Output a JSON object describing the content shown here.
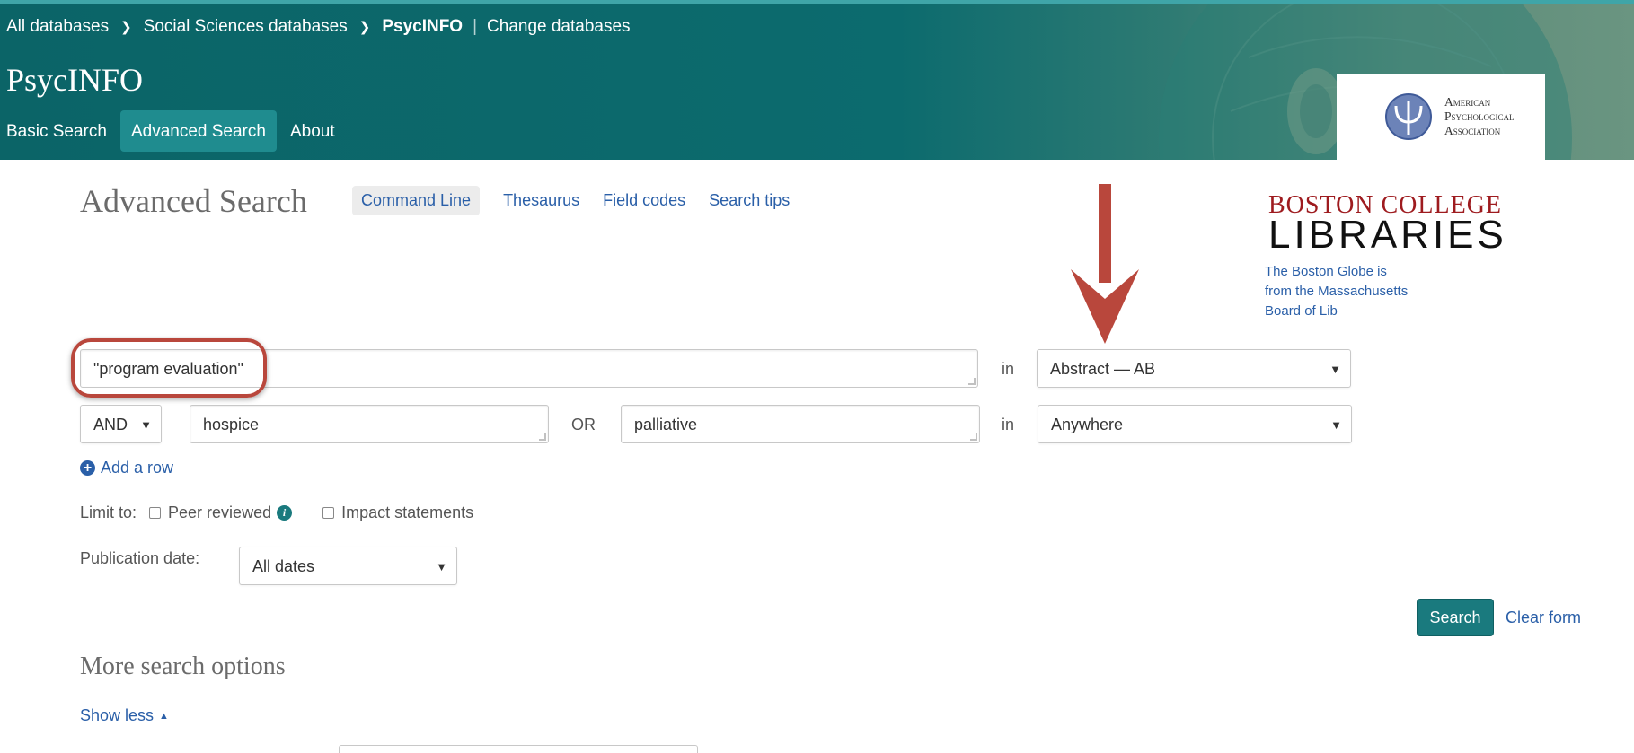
{
  "breadcrumb": {
    "items": [
      "All databases",
      "Social Sciences databases",
      "PsycINFO"
    ],
    "change_link": "Change databases"
  },
  "database_title": "PsycINFO",
  "nav": {
    "basic": "Basic Search",
    "advanced": "Advanced Search",
    "about": "About"
  },
  "apa_logo": {
    "line1": "American",
    "line2": "Psychological",
    "line3": "Association"
  },
  "page": {
    "title": "Advanced Search",
    "links": {
      "command_line": "Command Line",
      "thesaurus": "Thesaurus",
      "field_codes": "Field codes",
      "search_tips": "Search tips"
    }
  },
  "library": {
    "line1": "BOSTON COLLEGE",
    "line2": "LIBRARIES",
    "note": "The Boston Globe is from the Massachusetts Board of Lib"
  },
  "search_rows": {
    "row1": {
      "value": "\"program evaluation\"",
      "in_label": "in",
      "field": "Abstract — AB"
    },
    "row2": {
      "operator": "AND",
      "value1": "hospice",
      "or_label": "OR",
      "value2": "palliative",
      "in_label": "in",
      "field": "Anywhere"
    }
  },
  "add_row": "Add a row",
  "limit": {
    "label": "Limit to:",
    "peer_reviewed": "Peer reviewed",
    "impact": "Impact statements"
  },
  "pub_date": {
    "label": "Publication date:",
    "value": "All dates"
  },
  "actions": {
    "search": "Search",
    "clear": "Clear form"
  },
  "more": {
    "title": "More search options",
    "toggle": "Show less"
  },
  "colors": {
    "header": "#0c6b6e",
    "link": "#2a5fa8",
    "annotation": "#b9473c",
    "button": "#1a7a7e"
  }
}
